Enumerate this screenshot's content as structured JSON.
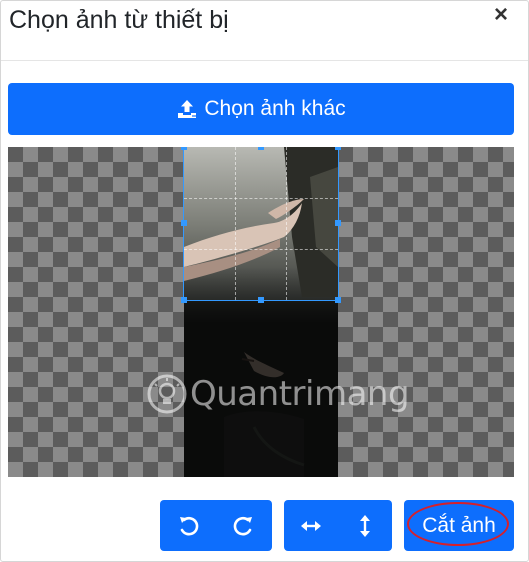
{
  "dialog": {
    "title": "Chọn ảnh từ thiết bị",
    "close_symbol": "×",
    "close_icon": "close-icon"
  },
  "upload": {
    "label": "Chọn ảnh khác",
    "icon": "upload-icon"
  },
  "crop": {
    "photo_colors": [
      "#1c1d1c",
      "#0e0f0e"
    ],
    "selection_color": "#3399ff",
    "checker_colors": [
      "#5c5c5c",
      "#8a8a8a"
    ]
  },
  "watermark": {
    "text": "Quantrimang",
    "icon": "lightbulb-logo"
  },
  "toolbar": {
    "rotate_left_icon": "rotate-left-icon",
    "rotate_right_icon": "rotate-right-icon",
    "flip_horizontal_icon": "flip-horizontal-icon",
    "flip_vertical_icon": "flip-vertical-icon",
    "crop_label": "Cắt ảnh"
  },
  "colors": {
    "primary": "#0d6efd",
    "highlight_ring": "#d6202b"
  }
}
